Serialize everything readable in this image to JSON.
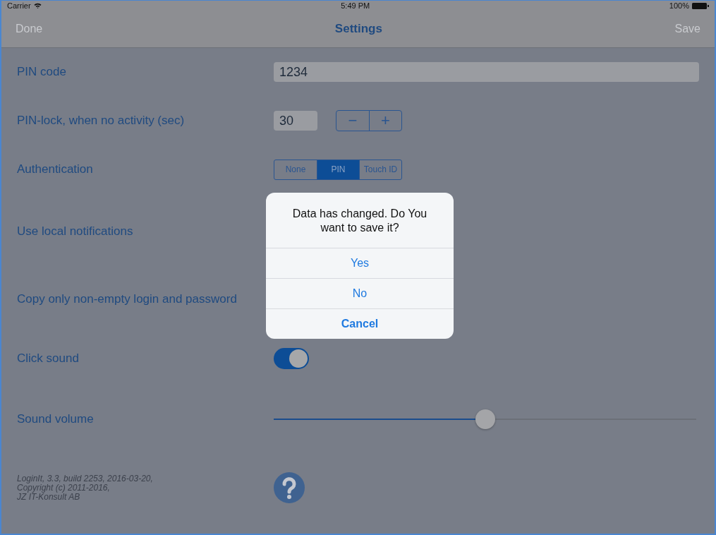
{
  "status_bar": {
    "carrier": "Carrier",
    "time": "5:49 PM",
    "battery": "100%"
  },
  "nav_bar": {
    "left": "Done",
    "title": "Settings",
    "right": "Save"
  },
  "rows": [
    {
      "kind": "text",
      "label": "PIN code",
      "value": "1234"
    },
    {
      "kind": "stepper",
      "label": "PIN-lock, when no activity (sec)",
      "value": "30",
      "minus": "−",
      "plus": "+"
    },
    {
      "kind": "segmented",
      "label": "Authentication",
      "options": [
        {
          "label": "None",
          "selected": false
        },
        {
          "label": "PIN",
          "selected": true
        },
        {
          "label": "Touch ID",
          "selected": false
        }
      ]
    },
    {
      "kind": "label",
      "label": "Use local notifications"
    },
    {
      "kind": "label",
      "label": "Copy only non-empty login and password"
    },
    {
      "kind": "switch",
      "label": "Click sound",
      "on": true
    },
    {
      "kind": "slider",
      "label": "Sound volume",
      "level": 0.5
    }
  ],
  "footer": {
    "lines": [
      "LoginIt, 3.3, build 2253, 2016-03-20,",
      "Copyright (c) 2011-2016,",
      "JZ IT-Konsult AB"
    ]
  },
  "alert": {
    "message": "Data has changed. Do You want to save it?",
    "buttons": [
      {
        "label": "Yes",
        "bold": false
      },
      {
        "label": "No",
        "bold": false
      },
      {
        "label": "Cancel",
        "bold": true
      }
    ]
  }
}
